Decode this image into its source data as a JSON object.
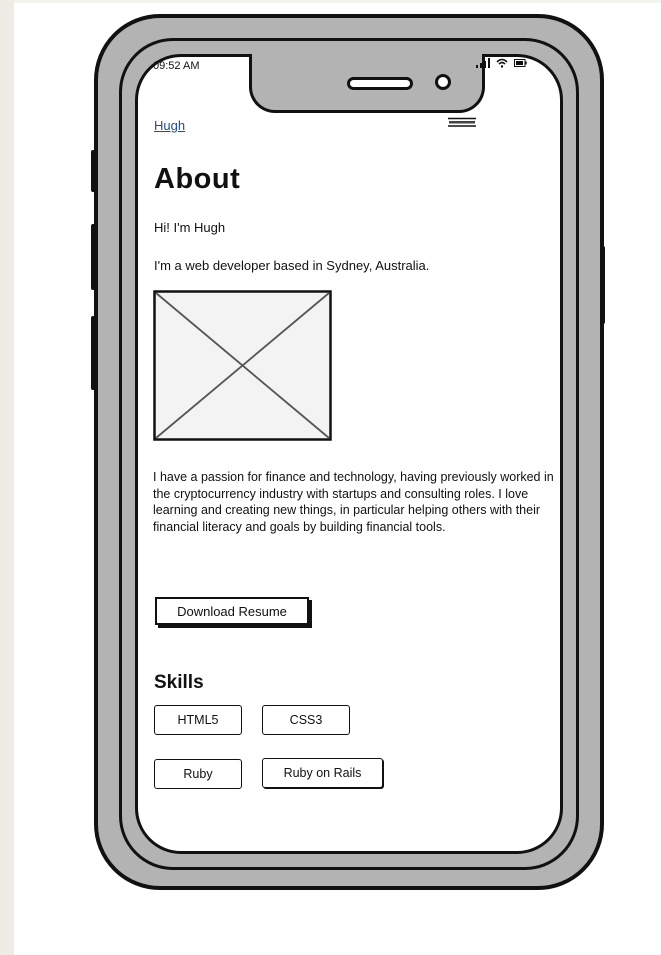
{
  "status_bar": {
    "time": "09:52 AM"
  },
  "header": {
    "brand": "Hugh",
    "menu_icon": "hamburger-menu-icon"
  },
  "main": {
    "title": "About",
    "greeting": "Hi! I'm Hugh",
    "intro": "I'm a web developer based in Sydney, Australia.",
    "image_icon": "image-placeholder-icon",
    "bio": "I have a passion for finance and technology, having previously worked in the cryptocurrency industry with startups and consulting roles. I love learning and creating new things, in particular helping others with their financial literacy and goals by building financial tools.",
    "resume_button": "Download Resume"
  },
  "skills": {
    "heading": "Skills",
    "items": [
      "HTML5",
      "CSS3",
      "Ruby",
      "Ruby on Rails"
    ]
  }
}
